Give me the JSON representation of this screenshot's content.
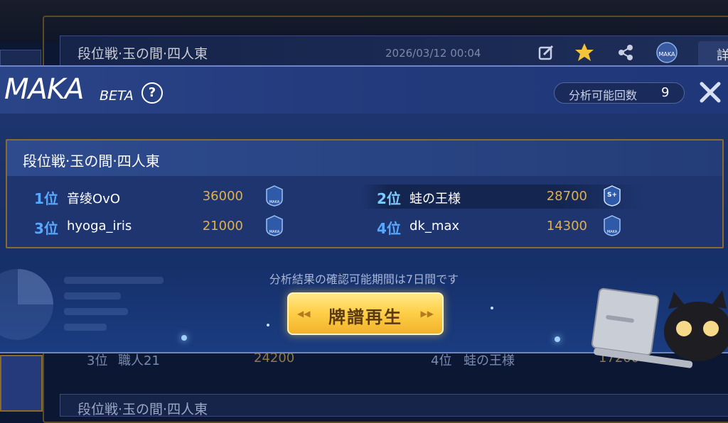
{
  "background": {
    "card_title": "段位戦·玉の間·四人東",
    "card_date": "2026/03/12 00:04",
    "tab_text": "詳",
    "row": {
      "rank3": "3位",
      "name3": "職人21",
      "score3": "24200",
      "rank4": "4位",
      "name4": "蛙の王様",
      "score4": "17200"
    },
    "card2_title": "段位戦·玉の間·四人東"
  },
  "modal": {
    "title": "MAKA",
    "beta": "BETA",
    "help": "?",
    "count_label": "分析可能回数",
    "count_value": "9",
    "match_title": "段位戦·玉の間·四人東",
    "players": [
      {
        "rank": "1位",
        "name": "音绫OvO",
        "score": "36000",
        "badge": "MAKA"
      },
      {
        "rank": "2位",
        "name": "蛙の王様",
        "score": "28700",
        "badge": "S+"
      },
      {
        "rank": "3位",
        "name": "hyoga_iris",
        "score": "21000",
        "badge": "MAKA"
      },
      {
        "rank": "4位",
        "name": "dk_max",
        "score": "14300",
        "badge": "MAKA"
      }
    ],
    "note": "分析結果の確認可能期間は7日間です",
    "replay_label": "牌譜再生"
  },
  "colors": {
    "rank_blue": "#58a8ff",
    "score_gold": "#e0b04a",
    "button_gold": "#ffd04a",
    "frame_gold": "#8c6c2c"
  },
  "icons": [
    "edit-icon",
    "star-icon",
    "share-icon",
    "maka-icon",
    "help-icon",
    "close-icon",
    "maka-badge-icon"
  ]
}
